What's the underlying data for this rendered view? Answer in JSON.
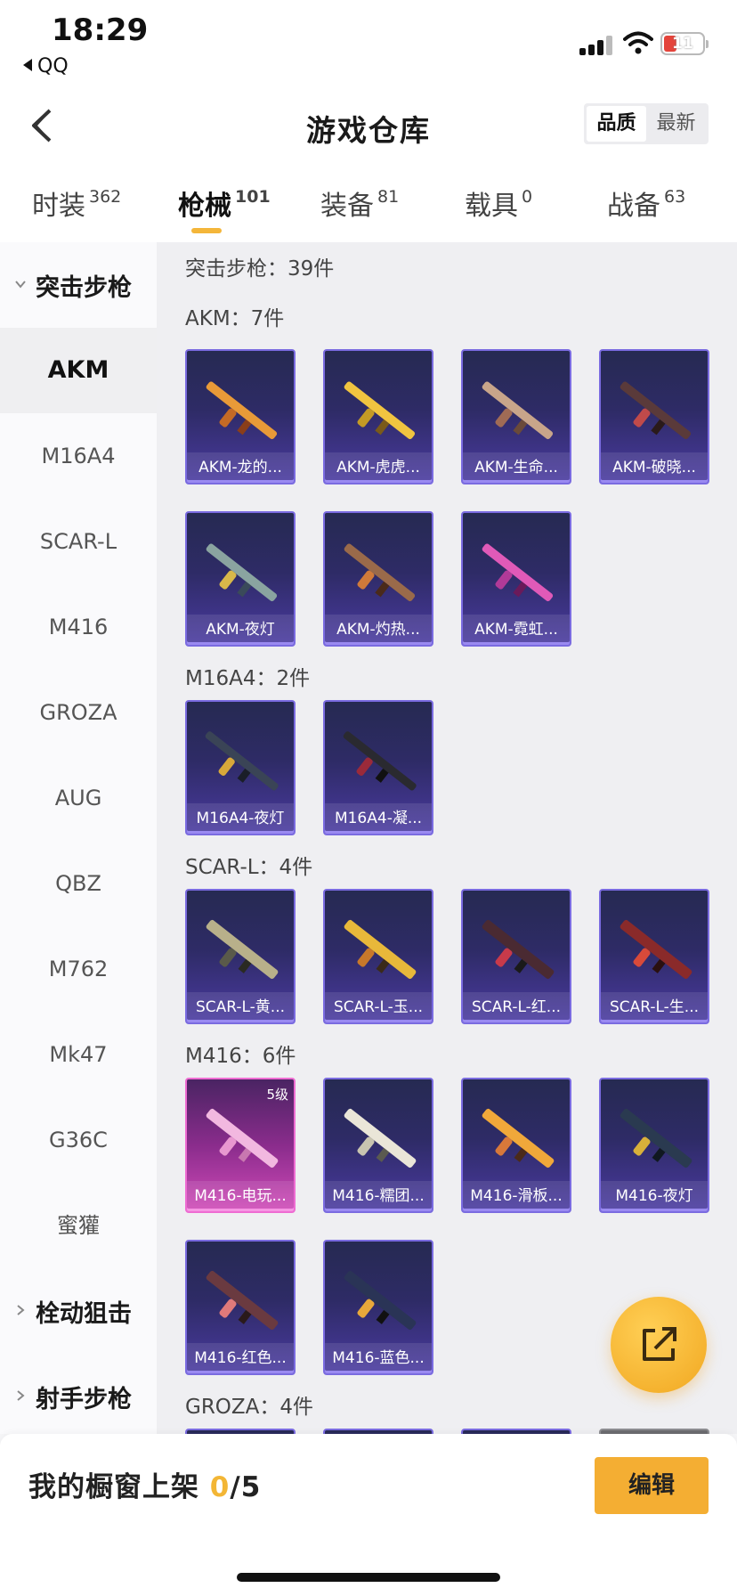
{
  "status": {
    "time": "18:29",
    "back_app": "QQ",
    "battery": "11"
  },
  "header": {
    "title": "游戏仓库",
    "sort_options": [
      "品质",
      "最新"
    ],
    "sort_active": "品质"
  },
  "tabs": [
    {
      "label": "时装",
      "count": "362"
    },
    {
      "label": "枪械",
      "count": "101"
    },
    {
      "label": "装备",
      "count": "81"
    },
    {
      "label": "载具",
      "count": "0"
    },
    {
      "label": "战备",
      "count": "63"
    }
  ],
  "sidebar": {
    "group_assault": "突击步枪",
    "items": [
      "AKM",
      "M16A4",
      "SCAR-L",
      "M416",
      "GROZA",
      "AUG",
      "QBZ",
      "M762",
      "Mk47",
      "G36C",
      "蜜獾"
    ],
    "group_bolt": "栓动狙击",
    "group_marksman": "射手步枪"
  },
  "content": {
    "category_title": "突击步枪：39件",
    "sections": [
      {
        "title": "AKM：7件",
        "items": [
          "AKM-龙的...",
          "AKM-虎虎...",
          "AKM-生命...",
          "AKM-破晓...",
          "AKM-夜灯",
          "AKM-灼热...",
          "AKM-霓虹..."
        ]
      },
      {
        "title": "M16A4：2件",
        "items": [
          "M16A4-夜灯",
          "M16A4-凝..."
        ]
      },
      {
        "title": "SCAR-L：4件",
        "items": [
          "SCAR-L-黄...",
          "SCAR-L-玉...",
          "SCAR-L-红...",
          "SCAR-L-生..."
        ]
      },
      {
        "title": "M416：6件",
        "items": [
          "M416-电玩...",
          "M416-糯团...",
          "M416-滑板...",
          "M416-夜灯",
          "M416-红色...",
          "M416-蓝色..."
        ],
        "level_badge": "5级"
      },
      {
        "title": "GROZA：4件"
      }
    ]
  },
  "bottom": {
    "shelf_label": "我的橱窗上架 ",
    "shelf_count": "0",
    "shelf_total": "/5",
    "edit_label": "编辑"
  },
  "colors": {
    "accent": "#f4ae33",
    "card_border": "#7a6be0",
    "card_bg": "#2e2b66",
    "pink_card": "#d04ab8"
  }
}
